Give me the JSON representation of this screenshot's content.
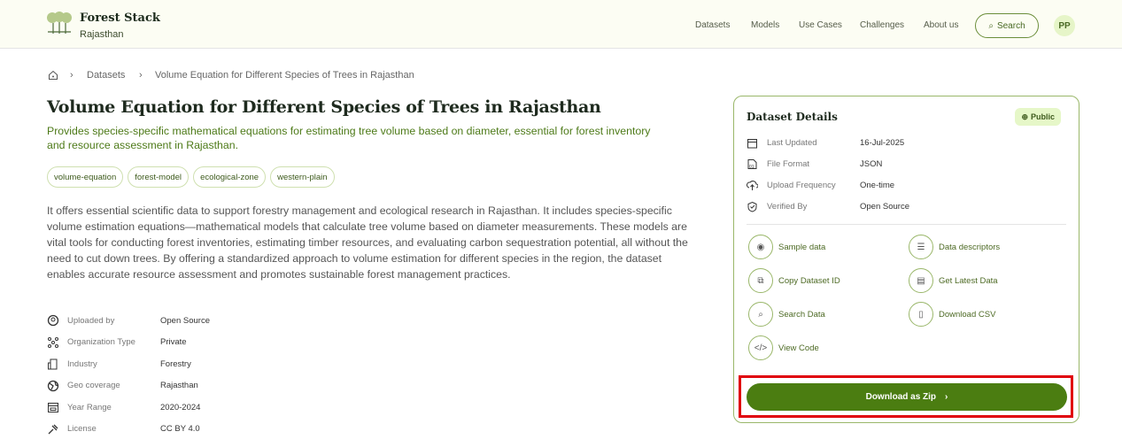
{
  "header": {
    "brand": "Forest Stack",
    "region": "Rajasthan",
    "nav": [
      "Datasets",
      "Models",
      "Use Cases",
      "Challenges",
      "About us"
    ],
    "search_label": "Search",
    "avatar": "PP"
  },
  "breadcrumb": {
    "items": [
      "Datasets",
      "Volume Equation for Different Species of Trees in Rajasthan"
    ]
  },
  "main": {
    "title": "Volume Equation for Different Species of Trees in Rajasthan",
    "subtitle": "Provides species-specific mathematical equations for estimating tree volume based on diameter, essential for forest inventory and resource assessment in Rajasthan.",
    "tags": [
      "volume-equation",
      "forest-model",
      "ecological-zone",
      "western-plain"
    ],
    "description": "It offers essential scientific data to support forestry management and ecological research in Rajasthan. It includes species-specific volume estimation equations—mathematical models that calculate tree volume based on diameter measurements. These models are vital tools for conducting forest inventories, estimating timber resources, and evaluating carbon sequestration potential, all without the need to cut down trees. By offering a standardized approach to volume estimation for different species in the region, the dataset enables accurate resource assessment and promotes sustainable forest management practices.",
    "meta": [
      {
        "icon": "user-circle-icon",
        "label": "Uploaded by",
        "value": "Open Source"
      },
      {
        "icon": "org-icon",
        "label": "Organization Type",
        "value": "Private"
      },
      {
        "icon": "building-icon",
        "label": "Industry",
        "value": "Forestry"
      },
      {
        "icon": "globe-icon",
        "label": "Geo coverage",
        "value": "Rajasthan"
      },
      {
        "icon": "calendar-icon",
        "label": "Year Range",
        "value": "2020-2024"
      },
      {
        "icon": "gavel-icon",
        "label": "License",
        "value": "CC BY 4.0"
      }
    ]
  },
  "details": {
    "title": "Dataset Details",
    "visibility": "Public",
    "rows": [
      {
        "icon": "calendar-icon",
        "label": "Last Updated",
        "value": "16-Jul-2025"
      },
      {
        "icon": "file-binary-icon",
        "label": "File Format",
        "value": "JSON"
      },
      {
        "icon": "cloud-upload-icon",
        "label": "Upload Frequency",
        "value": "One-time"
      },
      {
        "icon": "shield-check-icon",
        "label": "Verified By",
        "value": "Open Source"
      }
    ],
    "actions": [
      {
        "icon": "eye-icon",
        "label": "Sample data"
      },
      {
        "icon": "list-icon",
        "label": "Data descriptors"
      },
      {
        "icon": "copy-icon",
        "label": "Copy Dataset ID"
      },
      {
        "icon": "database-icon",
        "label": "Get Latest Data"
      },
      {
        "icon": "search-icon",
        "label": "Search Data"
      },
      {
        "icon": "file-csv-icon",
        "label": "Download CSV"
      },
      {
        "icon": "code-icon",
        "label": "View Code"
      }
    ],
    "download_label": "Download as Zip"
  },
  "colors": {
    "accent": "#4b7d11",
    "highlight": "#e0000a"
  }
}
